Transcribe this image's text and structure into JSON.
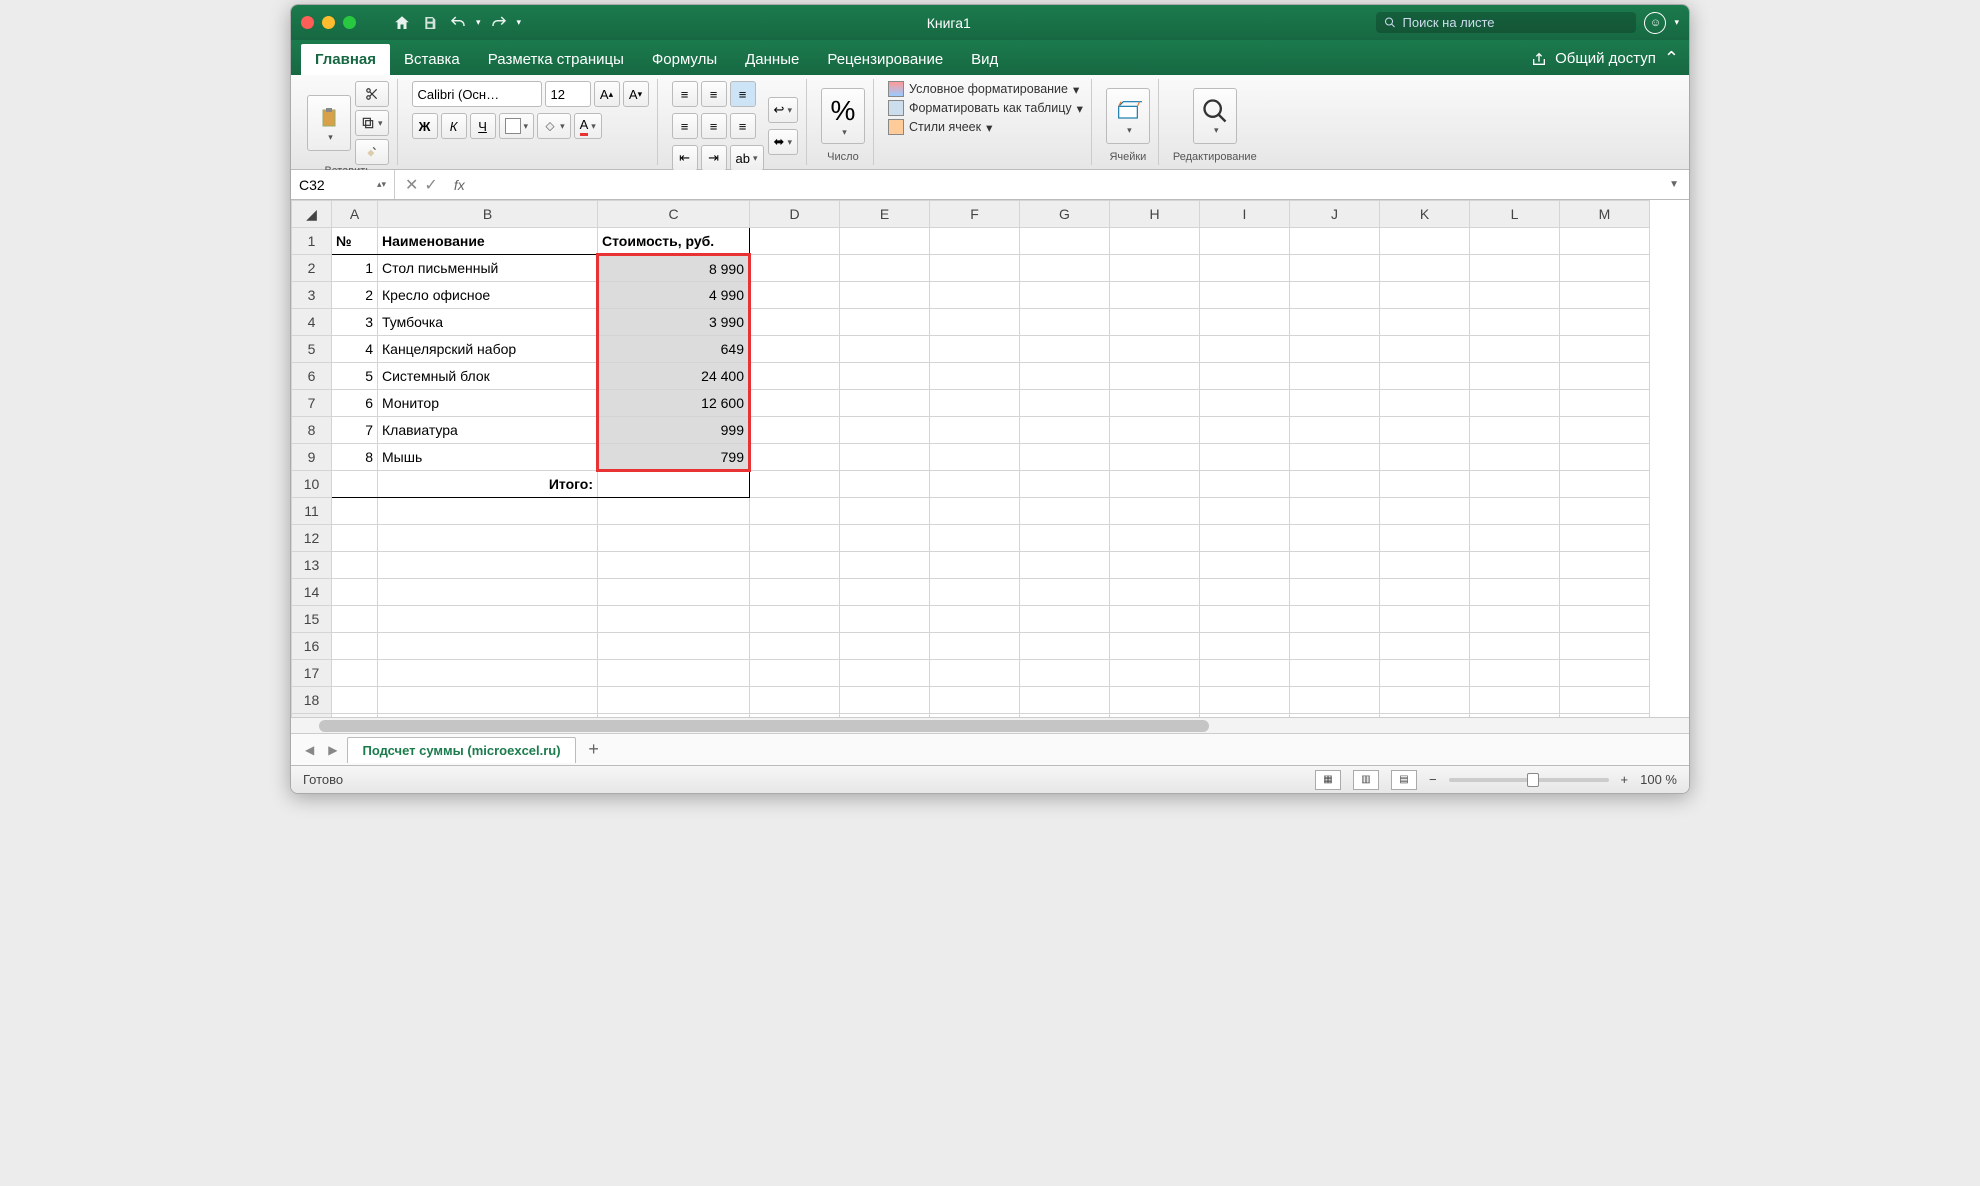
{
  "titlebar": {
    "title": "Книга1",
    "search_placeholder": "Поиск на листе"
  },
  "tabs": [
    "Главная",
    "Вставка",
    "Разметка страницы",
    "Формулы",
    "Данные",
    "Рецензирование",
    "Вид"
  ],
  "tabs_share": "Общий доступ",
  "ribbon": {
    "paste": "Вставить",
    "font_name": "Calibri (Осн…",
    "font_size": "12",
    "number": "Число",
    "cond_format": "Условное форматирование",
    "format_table": "Форматировать как таблицу",
    "cell_styles": "Стили ячеек",
    "cells": "Ячейки",
    "editing": "Редактирование"
  },
  "namebox": "C32",
  "columns": [
    "A",
    "B",
    "C",
    "D",
    "E",
    "F",
    "G",
    "H",
    "I",
    "J",
    "K",
    "L",
    "M"
  ],
  "headers": {
    "a": "№",
    "b": "Наименование",
    "c": "Стоимость, руб."
  },
  "rows": [
    {
      "n": "1",
      "name": "Стол письменный",
      "price": "8 990"
    },
    {
      "n": "2",
      "name": "Кресло офисное",
      "price": "4 990"
    },
    {
      "n": "3",
      "name": "Тумбочка",
      "price": "3 990"
    },
    {
      "n": "4",
      "name": "Канцелярский набор",
      "price": "649"
    },
    {
      "n": "5",
      "name": "Системный блок",
      "price": "24 400"
    },
    {
      "n": "6",
      "name": "Монитор",
      "price": "12 600"
    },
    {
      "n": "7",
      "name": "Клавиатура",
      "price": "999"
    },
    {
      "n": "8",
      "name": "Мышь",
      "price": "799"
    }
  ],
  "total_label": "Итого:",
  "sheet_tab": "Подсчет суммы (microexcel.ru)",
  "status": {
    "ready": "Готово",
    "zoom": "100 %"
  }
}
